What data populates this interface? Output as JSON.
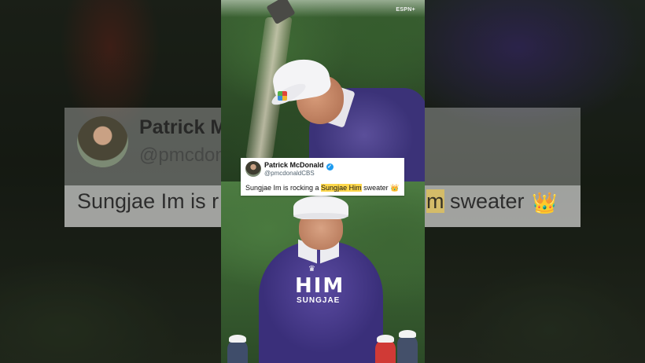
{
  "video": {
    "watermark": "ESPN+"
  },
  "tweet": {
    "name": "Patrick McDonald",
    "handle": "@pmcdonaldCBS",
    "text_before": "Sungjae Im is rocking a ",
    "text_highlight": "Sungjae Him",
    "text_after": " sweater ",
    "emoji": "👑",
    "verified_icon": "✓"
  },
  "background_tweet": {
    "name_partial": "Patrick M",
    "handle_partial": "@pmcdon",
    "text_left_partial": "Sungjae Im is r",
    "text_right_highlight": "m",
    "text_right_after": " sweater",
    "emoji": "👑"
  },
  "golfer_bottom": {
    "sweater_him": "HIM",
    "sweater_sungjae": "SUNGJAE",
    "sweater_script": "~"
  },
  "colors": {
    "highlight": "#ffd84d",
    "verified": "#1d9bf0",
    "sweater_purple": "#3b3278"
  }
}
